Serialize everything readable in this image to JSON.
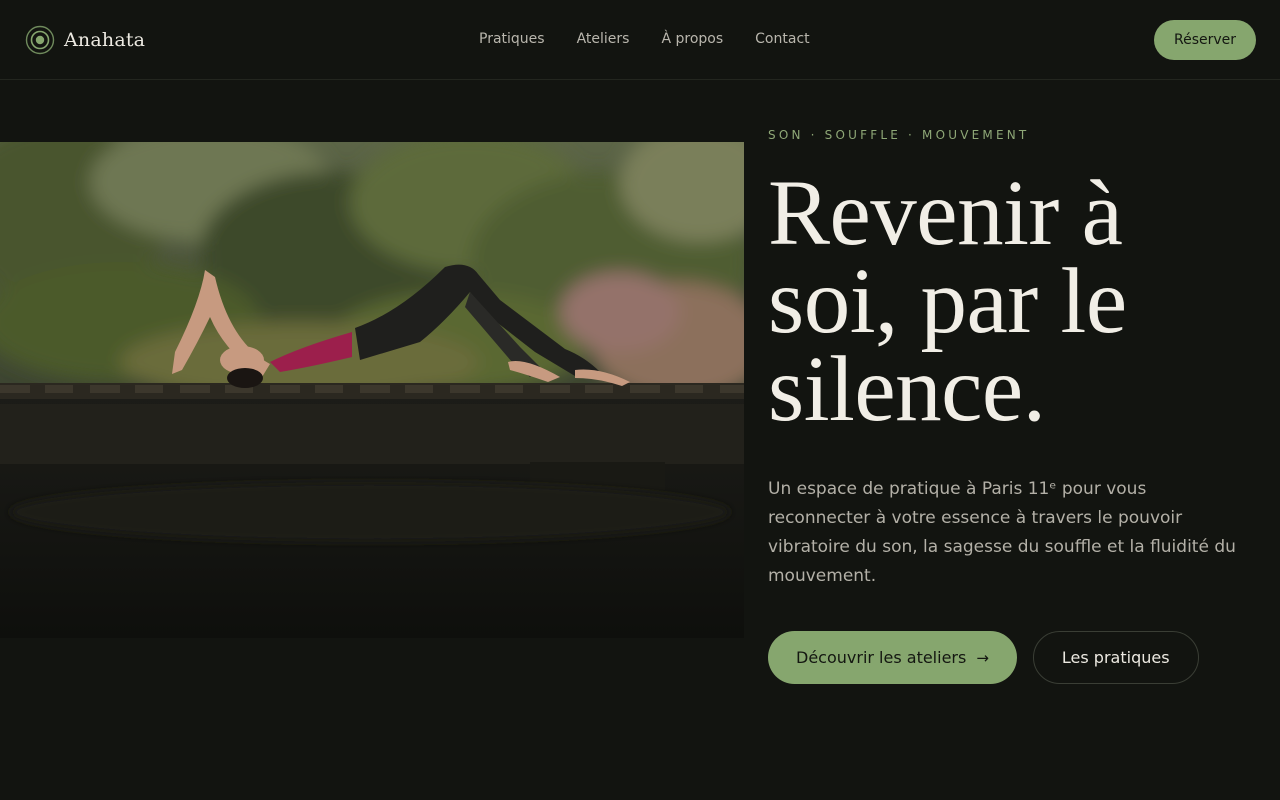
{
  "brand": {
    "name": "Anahata",
    "logo_icon": "circle-dot-icon",
    "accent": "#86a66e"
  },
  "nav": {
    "items": [
      "Pratiques",
      "Ateliers",
      "À propos",
      "Contact"
    ]
  },
  "header": {
    "reserve_label": "Réserver"
  },
  "hero": {
    "eyebrow": "SON · SOUFFLE · MOUVEMENT",
    "headline": "Revenir à soi, par le silence.",
    "intro": "Un espace de pratique à Paris 11ᵉ pour vous reconnecter à votre essence à travers le pouvoir vibratoire du son, la sagesse du souffle et la fluidité du mouvement.",
    "cta_primary": "Découvrir les ateliers",
    "cta_primary_icon": "arrow-right-icon",
    "cta_arrow": "→",
    "cta_secondary": "Les pratiques"
  },
  "colors": {
    "background": "#121410",
    "accent": "#86a66e",
    "text": "#ece9e1",
    "muted": "#b3b0a7"
  }
}
